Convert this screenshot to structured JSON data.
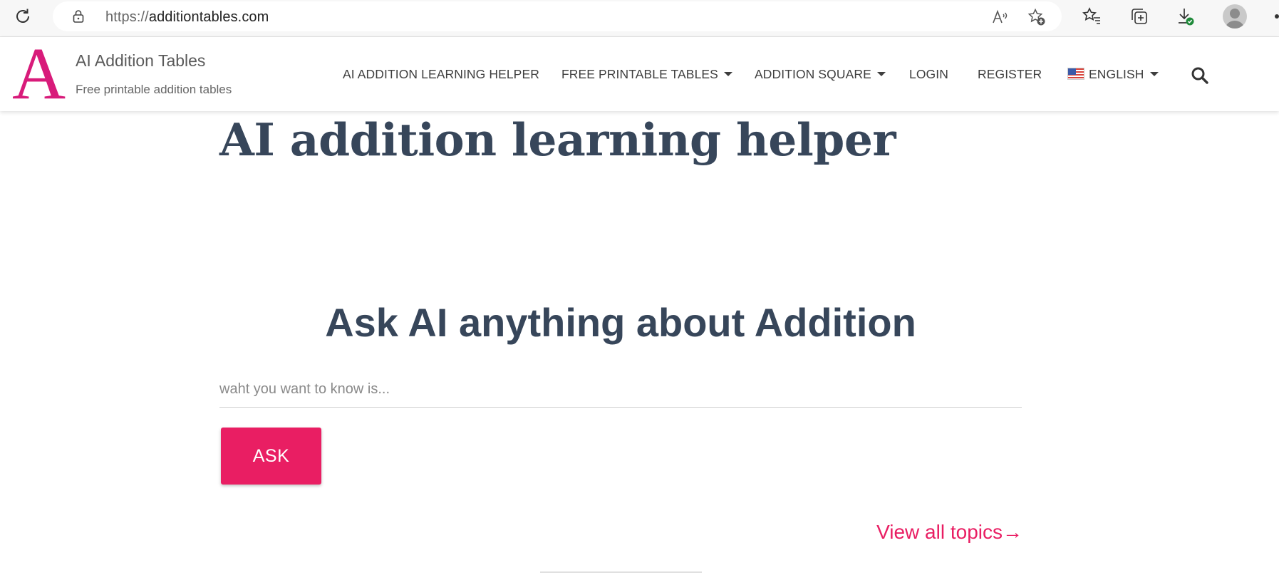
{
  "browser": {
    "url_scheme": "https://",
    "url_host": "additiontables.com",
    "toolbar_icons": [
      "reload-icon",
      "lock-icon",
      "read-aloud-icon",
      "add-favorite-icon",
      "favorites-icon",
      "collections-icon",
      "downloads-icon",
      "profile-avatar"
    ]
  },
  "site": {
    "logo_letter": "A",
    "name": "AI Addition Tables",
    "tagline": "Free printable addition tables",
    "brand_color": "#d81b7a"
  },
  "nav": {
    "items": [
      {
        "label": "AI ADDITION LEARNING HELPER",
        "has_dropdown": false
      },
      {
        "label": "FREE PRINTABLE TABLES",
        "has_dropdown": true
      },
      {
        "label": "ADDITION SQUARE",
        "has_dropdown": true
      },
      {
        "label": "LOGIN",
        "has_dropdown": false
      },
      {
        "label": "REGISTER",
        "has_dropdown": false
      },
      {
        "label": "ENGLISH",
        "has_dropdown": true,
        "icon": "us-flag-icon"
      }
    ],
    "search_icon": "search-icon"
  },
  "main": {
    "title": "AI addition learning helper",
    "ask_heading": "Ask AI anything about Addition",
    "question_input": {
      "value": "",
      "placeholder": "waht you want to know is..."
    },
    "ask_button_label": "ASK",
    "topics_link": "View all topics→",
    "accent_color": "#e91e63",
    "text_color": "#37465a"
  }
}
